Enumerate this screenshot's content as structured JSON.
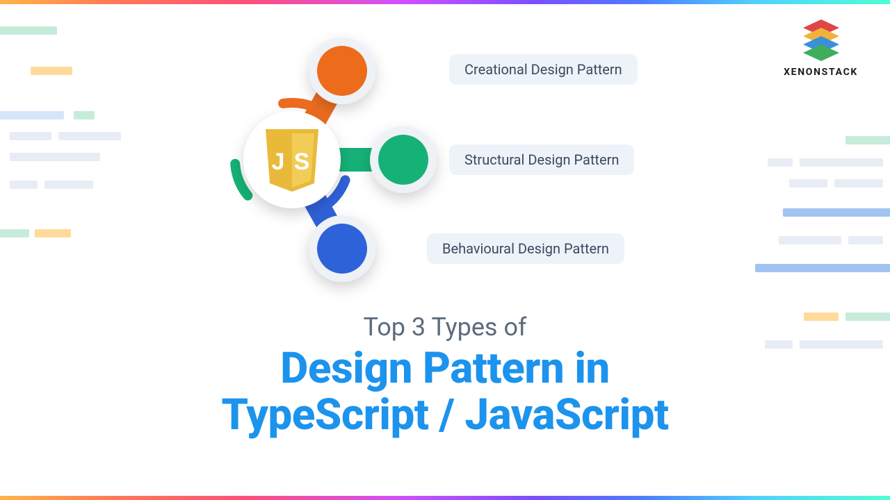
{
  "brand": {
    "name": "XENONSTACK"
  },
  "diagram": {
    "center_icon": "javascript-shield-icon",
    "nodes": [
      {
        "label": "Creational Design Pattern",
        "color": "#ec6c1f"
      },
      {
        "label": "Structural Design Pattern",
        "color": "#15b177"
      },
      {
        "label": "Behavioural Design Pattern",
        "color": "#2f62d9"
      }
    ]
  },
  "headline": {
    "eyebrow": "Top 3 Types of",
    "title_line1": "Design Pattern in",
    "title_line2": "TypeScript / JavaScript"
  },
  "colors": {
    "pill_bg": "#eef3fa",
    "pill_text": "#3c4a5a",
    "headline_blue": "#1c93ed",
    "eyebrow_grey": "#5a6b7d"
  }
}
